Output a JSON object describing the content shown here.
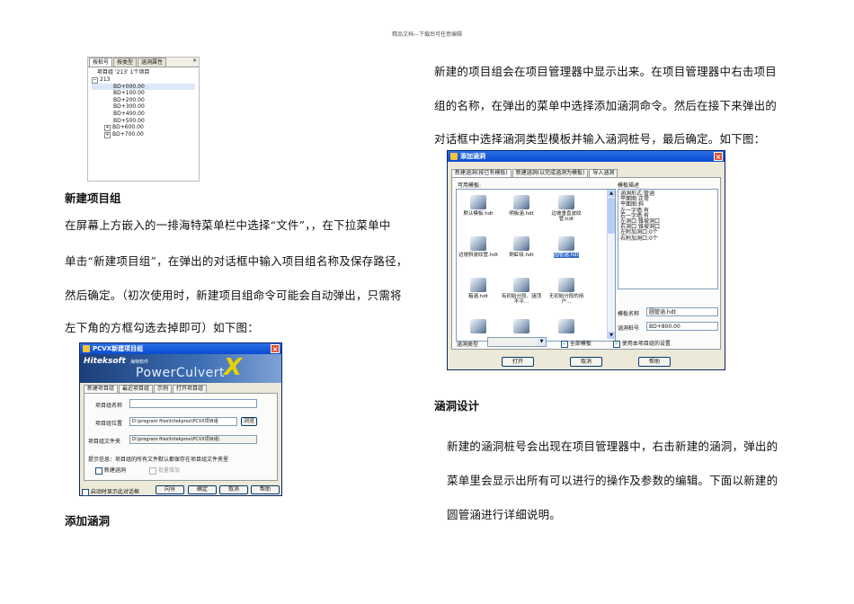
{
  "header_note": "精品文档---下载后可任意编辑",
  "tree_panel": {
    "tabs": [
      "按桩号",
      "按类型",
      "涵洞属性"
    ],
    "close": "×",
    "group_label": "项目组 '213' 1个项目",
    "project": "213",
    "items": [
      "BD+000.00",
      "BD+100.00",
      "BD+200.00",
      "BD+300.00",
      "BD+400.00",
      "BD+500.00",
      "BD+600.00",
      "BD+700.00"
    ]
  },
  "left": {
    "heading1": "新建项目组",
    "para1": [
      "在屏幕上方嵌入的一排海特菜单栏中选择“文件”，，在下拉菜单中",
      "单击“新建项目组”，在弹出的对话框中输入项目组名称及保存路径，",
      "然后确定。（初次使用时，新建项目组命令可能会自动弹出，只需将",
      "左下角的方框勾选去掉即可）如下图："
    ],
    "heading2": "添加涵洞"
  },
  "pcvx": {
    "title": "PCVX新建项目组",
    "brand": "Hiteksoft",
    "brand_cn": "海特软件",
    "product": "PowerCulvert",
    "tabs": [
      "新建项目组",
      "最近项目组",
      "示例",
      "打开项目组"
    ],
    "name_label": "项目组名称",
    "name_value": "",
    "location_label": "项目组位置",
    "location_value": "D:\\program files\\hitekprov\\PCVX项目组",
    "browse": "浏览",
    "folder_label": "项目组文件夹",
    "folder_value": "D:\\program files\\hitekprov\\PCVX项目组\\",
    "hint": "提示信息：项目组的所有文件默认都保存在项目组文件夹里",
    "new_culvert": "新建涵洞",
    "batch_add": "批量增加",
    "startup": "启动时显示此对话框",
    "buttons": [
      "向导",
      "确定",
      "取消",
      "帮助"
    ]
  },
  "right": {
    "para1": [
      "新建的项目组会在项目管理器中显示出来。在项目管理器中右击项目",
      "组的名称，在弹出的菜单中选择添加涵洞命令。然后在接下来弹出的",
      "对话框中选择涵洞类型模板并输入涵洞桩号，最后确定。如下图："
    ],
    "heading": "涵洞设计",
    "para2": [
      "新建的涵洞桩号会出现在项目管理器中，右击新建的涵洞，弹出的",
      "菜单里会显示出所有可以进行的操作及参数的编辑。下面以新建的",
      "圆管涵进行详细说明。"
    ]
  },
  "add_culvert": {
    "title": "添加涵洞",
    "tabs": [
      "新建涵洞(按已有模板)",
      "新建涵洞(以完成涵洞为模板)",
      "导入涵洞"
    ],
    "templates_label": "可用模板:",
    "templates": [
      "默认模板.hdt",
      "明板涵.hdt",
      "边坡垂直波纹管.hdt",
      "边坡斜波纹管.hdt",
      "倒虹吸.hdt",
      "圆管涵.hdt",
      "箱涵.hdt",
      "有初始分段、涵顶不平...",
      "无初始分段的用户..."
    ],
    "desc_label": "模板描述",
    "desc_lines": [
      "涵洞形式:管涵",
      "平面图:正常",
      "平面图:斜",
      "左一字墙:有",
      "右一字墙:有",
      "左洞口:锥坡洞口",
      "右洞口:锥坡洞口",
      "左附加洞口:0个",
      "右附加洞口:0个"
    ],
    "template_name_label": "模板名称",
    "template_name_value": "圆管涵.hdt",
    "station_label": "涵洞桩号",
    "station_value": "BD+800.00",
    "type_label": "涵洞类型",
    "all_templates": "全部模板",
    "use_settings": "使用本项目组的设置",
    "buttons": [
      "打开",
      "取消",
      "帮助"
    ]
  }
}
